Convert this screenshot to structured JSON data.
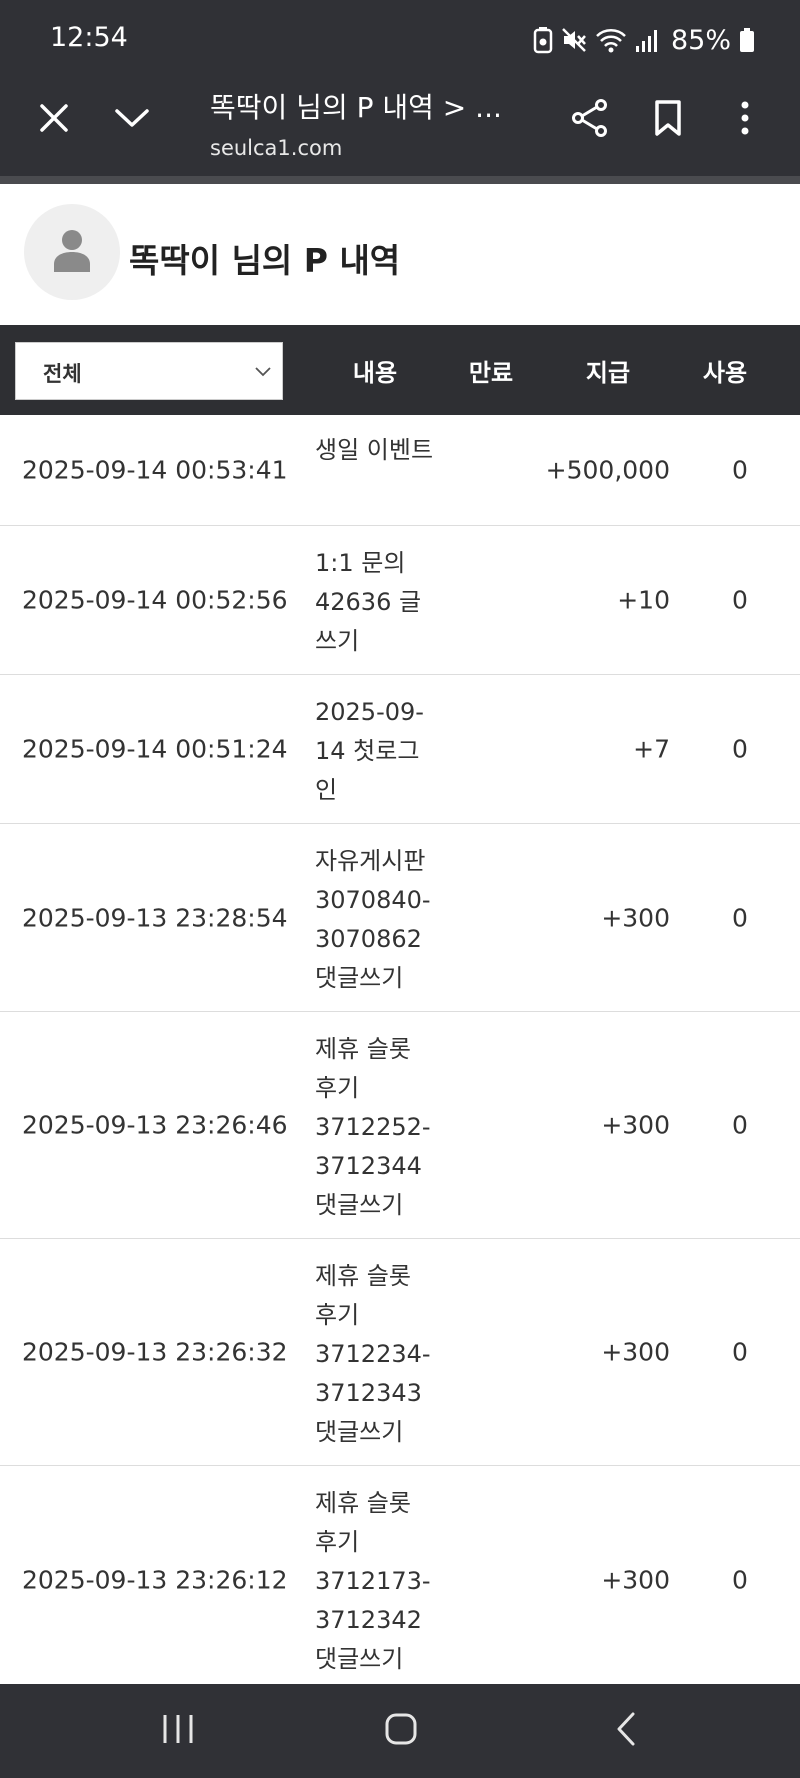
{
  "status_bar": {
    "time": "12:54",
    "battery_percent": "85%",
    "icons": [
      "battery-saver-icon",
      "mute-icon",
      "wifi-icon",
      "signal-icon",
      "battery-icon"
    ]
  },
  "browser": {
    "page_title": "똑딱이 님의 P 내역 > ...",
    "domain": "seulca1.com",
    "icons": [
      "close-icon",
      "chevron-down-icon",
      "share-icon",
      "bookmark-icon",
      "more-icon"
    ]
  },
  "profile": {
    "title": "똑딱이 님의 P 내역"
  },
  "table": {
    "filter_value": "전체",
    "headers": {
      "content": "내용",
      "expiry": "만료",
      "grant": "지급",
      "used": "사용"
    },
    "rows": [
      {
        "date": "2025-09-14 00:53:41",
        "content": "생일 이벤트",
        "expiry": "",
        "grant": "+500,000",
        "used": "0"
      },
      {
        "date": "2025-09-14 00:52:56",
        "content": "1:1 문의 42636 글쓰기",
        "expiry": "",
        "grant": "+10",
        "used": "0"
      },
      {
        "date": "2025-09-14 00:51:24",
        "content": "2025-09-14 첫로그인",
        "expiry": "",
        "grant": "+7",
        "used": "0"
      },
      {
        "date": "2025-09-13 23:28:54",
        "content": "자유게시판 3070840-3070862 댓글쓰기",
        "expiry": "",
        "grant": "+300",
        "used": "0"
      },
      {
        "date": "2025-09-13 23:26:46",
        "content": "제휴 슬롯 후기 3712252-3712344 댓글쓰기",
        "expiry": "",
        "grant": "+300",
        "used": "0"
      },
      {
        "date": "2025-09-13 23:26:32",
        "content": "제휴 슬롯 후기 3712234-3712343 댓글쓰기",
        "expiry": "",
        "grant": "+300",
        "used": "0"
      },
      {
        "date": "2025-09-13 23:26:12",
        "content": "제휴 슬롯 후기 3712173-3712342 댓글쓰기",
        "expiry": "",
        "grant": "+300",
        "used": "0"
      }
    ]
  },
  "nav_bar": {
    "icons": [
      "recent-apps-icon",
      "home-icon",
      "back-icon"
    ]
  }
}
